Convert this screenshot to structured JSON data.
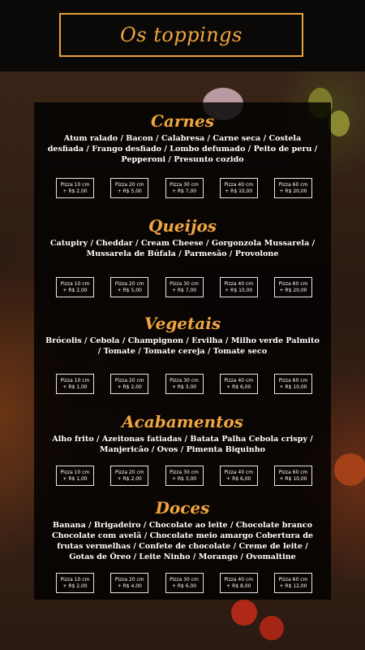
{
  "header": {
    "title": "Os toppings"
  },
  "sections": [
    {
      "title": "Carnes",
      "items": "Atum ralado / Bacon / Calabresa / Carne seca / Costela desfiada / Frango desfiado / Lombo defumado / Peito de peru / Pepperoni / Presunto cozido",
      "prices": [
        {
          "size": "Pizza 10 cm",
          "price": "+ R$ 2,00"
        },
        {
          "size": "Pizza 20 cm",
          "price": "+ R$ 5,00"
        },
        {
          "size": "Pizza 30 cm",
          "price": "+ R$ 7,00"
        },
        {
          "size": "Pizza 40 cm",
          "price": "+ R$ 10,00"
        },
        {
          "size": "Pizza 60 cm",
          "price": "+ R$ 20,00"
        }
      ]
    },
    {
      "title": "Queijos",
      "items": "Catupiry / Cheddar / Cream Cheese / Gorgonzola Mussarela / Mussarela de Búfala / Parmesão / Provolone",
      "prices": [
        {
          "size": "Pizza 10 cm",
          "price": "+ R$ 2,00"
        },
        {
          "size": "Pizza 20 cm",
          "price": "+ R$ 5,00"
        },
        {
          "size": "Pizza 30 cm",
          "price": "+ R$ 7,00"
        },
        {
          "size": "Pizza 40 cm",
          "price": "+ R$ 10,00"
        },
        {
          "size": "Pizza 60 cm",
          "price": "+ R$ 20,00"
        }
      ]
    },
    {
      "title": "Vegetais",
      "items": "Brócolis / Cebola / Champignon / Ervilha / Milho verde Palmito / Tomate / Tomate cereja / Tomate seco",
      "prices": [
        {
          "size": "Pizza 10 cm",
          "price": "+ R$ 1,00"
        },
        {
          "size": "Pizza 20 cm",
          "price": "+ R$ 2,00"
        },
        {
          "size": "Pizza 30 cm",
          "price": "+ R$ 3,00"
        },
        {
          "size": "Pizza 40 cm",
          "price": "+ R$ 6,00"
        },
        {
          "size": "Pizza 60 cm",
          "price": "+ R$ 10,00"
        }
      ]
    },
    {
      "title": "Acabamentos",
      "items": "Alho frito / Azeitonas fatiadas / Batata Palha Cebola crispy / Manjericão / Ovos / Pimenta Biquinho",
      "prices": [
        {
          "size": "Pizza 10 cm",
          "price": "+ R$ 1,00"
        },
        {
          "size": "Pizza 20 cm",
          "price": "+ R$ 2,00"
        },
        {
          "size": "Pizza 30 cm",
          "price": "+ R$ 3,00"
        },
        {
          "size": "Pizza 40 cm",
          "price": "+ R$ 6,00"
        },
        {
          "size": "Pizza 60 cm",
          "price": "+ R$ 10,00"
        }
      ]
    },
    {
      "title": "Doces",
      "items": "Banana / Brigadeiro / Chocolate ao leite / Chocolate branco Chocolate com avelã / Chocolate meio amargo Cobertura de frutas vermelhas / Confete de chocolate / Creme de leite / Gotas de Óreo / Leite Ninho / Morango / Ovomaltine",
      "prices": [
        {
          "size": "Pizza 10 cm",
          "price": "+ R$ 2,00"
        },
        {
          "size": "Pizza 20 cm",
          "price": "+ R$ 4,00"
        },
        {
          "size": "Pizza 30 cm",
          "price": "+ R$ 6,00"
        },
        {
          "size": "Pizza 40 cm",
          "price": "+ R$ 8,00"
        },
        {
          "size": "Pizza 60 cm",
          "price": "+ R$ 12,00"
        }
      ]
    }
  ],
  "colors": {
    "accent": "#f0a640",
    "background": "#0a0807",
    "panel": "#000000",
    "text": "#ffffff"
  }
}
